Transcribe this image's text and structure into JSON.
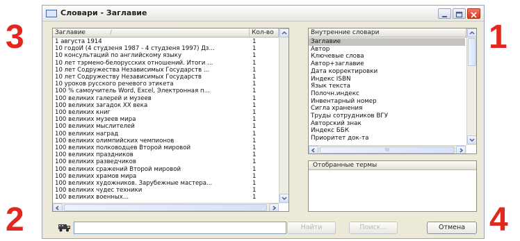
{
  "window": {
    "title": "Словари - Заглавие"
  },
  "annotations": [
    "3",
    "1",
    "2",
    "4"
  ],
  "titles_list": {
    "columns": [
      "Заглавие",
      "Кол-во"
    ],
    "sort_indicator": "/",
    "rows": [
      {
        "title": "1 августа 1914",
        "count": "1"
      },
      {
        "title": "10 годоЙ (4 студзеня 1987 - 4 студзеня 1997) Дз...",
        "count": "1"
      },
      {
        "title": "10 консультаций по английскому языку",
        "count": "1"
      },
      {
        "title": "10 лет тэрмено-белорусских отношений. Итоги ...",
        "count": "1"
      },
      {
        "title": "10 лет Содружества Независимых Государств ...",
        "count": "1"
      },
      {
        "title": "10 лет Содружеству Независимых Государств",
        "count": "1"
      },
      {
        "title": "10 уроков русского речевого этикета",
        "count": "1"
      },
      {
        "title": "100 % самоучитель Word, Excel, Электронная п...",
        "count": "1"
      },
      {
        "title": "100 великих галерей и музеев",
        "count": "1"
      },
      {
        "title": "100 великих загадок XX века",
        "count": "1"
      },
      {
        "title": "100 великих книг",
        "count": "1"
      },
      {
        "title": "100 великих музеев мира",
        "count": "1"
      },
      {
        "title": "100 великих мыслителей",
        "count": "1"
      },
      {
        "title": "100 великих наград",
        "count": "1"
      },
      {
        "title": "100 великих олимпийских чемпионов",
        "count": "1"
      },
      {
        "title": "100 великих полководцев Второй мировой",
        "count": "1"
      },
      {
        "title": "100 великих праздников",
        "count": "1"
      },
      {
        "title": "100 великих разведчиков",
        "count": "1"
      },
      {
        "title": "100 великих сражений Второй мировой",
        "count": "1"
      },
      {
        "title": "100 великих храмов мира",
        "count": "1"
      },
      {
        "title": "100 великих художников. Зарубежные мастера...",
        "count": "1"
      },
      {
        "title": "100 великих чудес техники",
        "count": "1"
      },
      {
        "title": "100 великих военных...",
        "count": "1"
      }
    ]
  },
  "dictionaries": {
    "header": "Внутренние словари",
    "items": [
      "Заглавие",
      "Автор",
      "Ключевые слова",
      "Автор+заглавие",
      "Дата корректировки",
      "Индекс ISBN",
      "Язык текста",
      "Полочн.индекс",
      "Инвентарный номер",
      "Сигла хранения",
      "Труды сотрудников ВГУ",
      "Авторский знак",
      "Индекс ББК",
      "Приоритет док-та"
    ],
    "selected_index": 0,
    "hscroll_glyph": "III"
  },
  "selected_terms": {
    "header": "Отобранные термы"
  },
  "bottom": {
    "search_value": "",
    "find_label": "Найти",
    "search_label": "Поиск...",
    "cancel_label": "Отмена"
  },
  "colors": {
    "annotation": "#e0281e",
    "selection": "#c5c3bd",
    "window_bg": "#ece9d8"
  }
}
